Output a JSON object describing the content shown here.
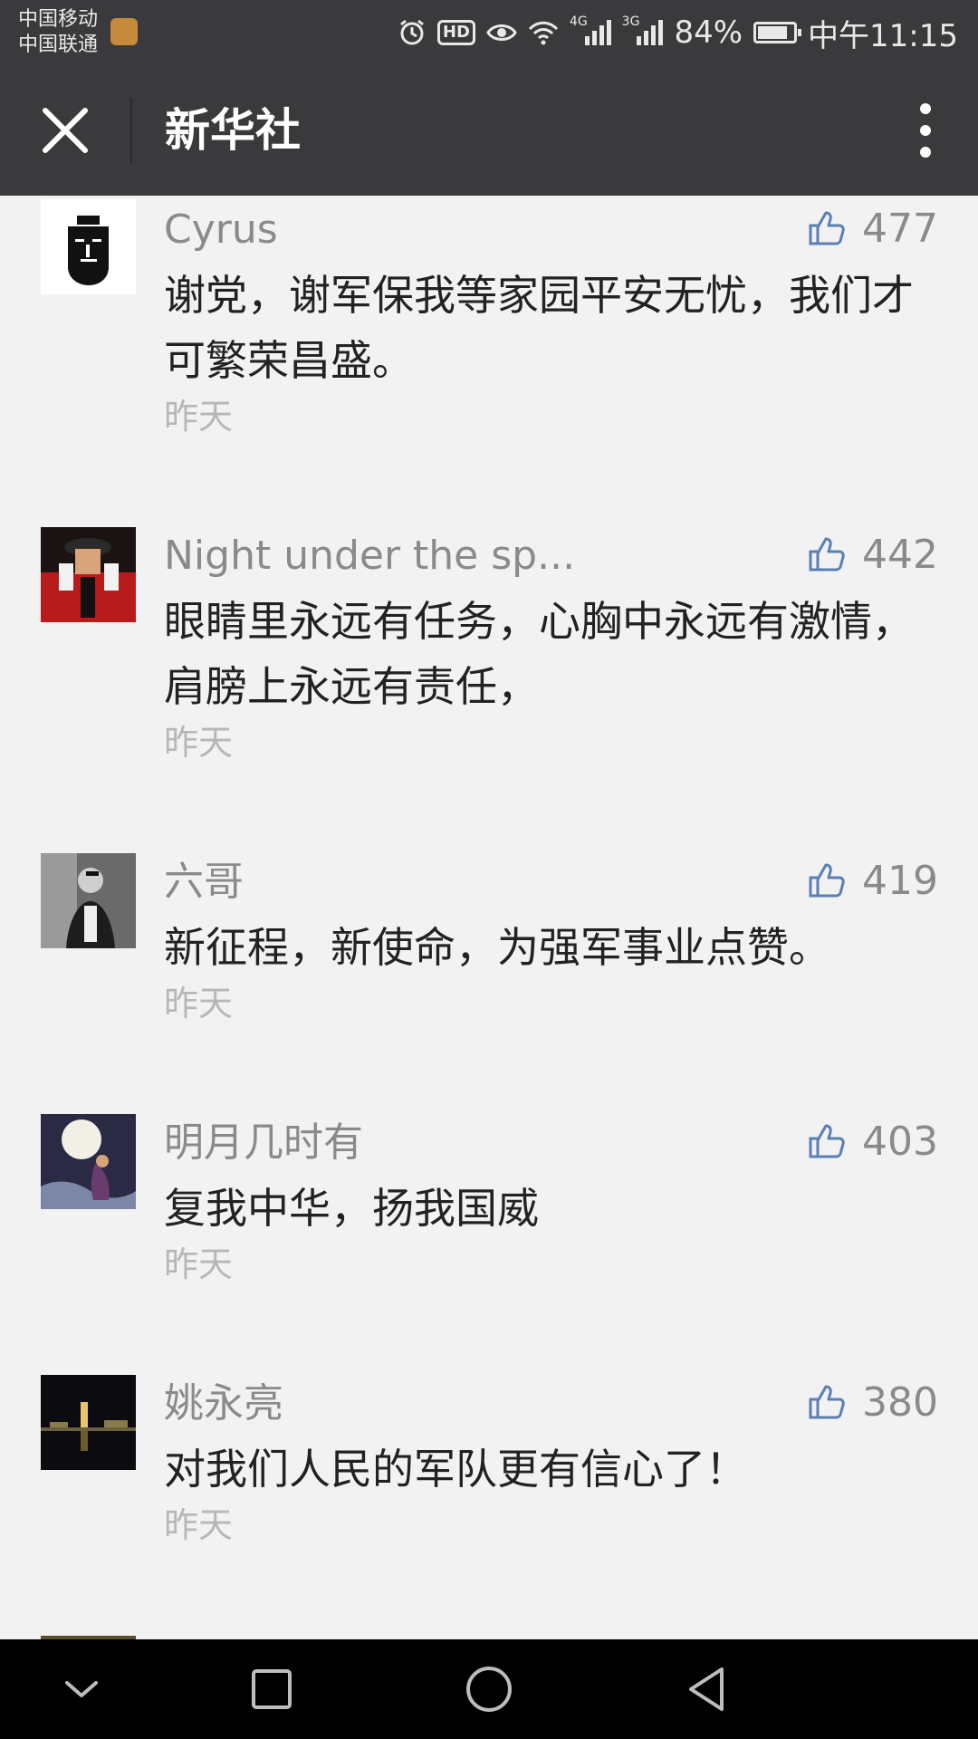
{
  "status_bar": {
    "carrier_1": "中国移动",
    "carrier_2": "中国联通",
    "hd_label": "HD",
    "net_4g": "4G",
    "net_3g": "3G",
    "battery_percent": "84%",
    "battery_level": 0.84,
    "time": "中午11:15"
  },
  "title_bar": {
    "title": "新华社"
  },
  "comments": [
    {
      "nickname": "Cyrus",
      "likes": "477",
      "text": "谢党，谢军保我等家园平安无忧，我们才可繁荣昌盛。",
      "time": "昨天"
    },
    {
      "nickname": "Night under the sp...",
      "likes": "442",
      "text": "眼睛里永远有任务，心胸中永远有激情，肩膀上永远有责任，",
      "time": "昨天"
    },
    {
      "nickname": "六哥",
      "likes": "419",
      "text": "新征程，新使命，为强军事业点赞。",
      "time": "昨天"
    },
    {
      "nickname": "明月几时有",
      "likes": "403",
      "text": "复我中华，扬我国威",
      "time": "昨天"
    },
    {
      "nickname": "姚永亮",
      "likes": "380",
      "text": "对我们人民的军队更有信心了！",
      "time": "昨天"
    }
  ],
  "colors": {
    "bar_bg": "#3a3a3d",
    "page_bg": "#f2f2f2",
    "like_icon": "#5b7fb5",
    "muted_text": "#8a8a8a"
  }
}
